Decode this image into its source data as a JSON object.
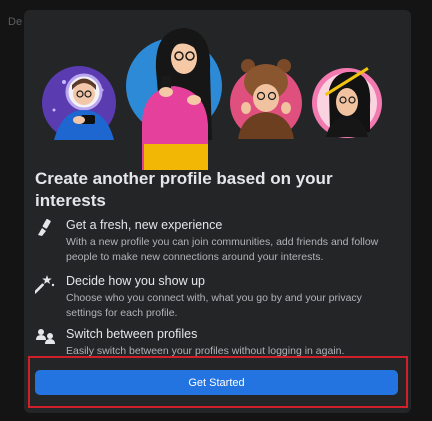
{
  "background": {
    "text": "De"
  },
  "dialog": {
    "title": "Create another profile based on your interests",
    "features": [
      {
        "icon": "paintbrush-icon",
        "heading": "Get a fresh, new experience",
        "desc_lines": [
          "With a new profile you can join communities, add friends and follow",
          "people to make new connections around your interests."
        ]
      },
      {
        "icon": "magic-wand-icon",
        "heading": "Decide how you show up",
        "desc_lines": [
          "Choose who you connect with, what you go by and your privacy",
          "settings for each profile."
        ]
      },
      {
        "icon": "switch-profiles-icon",
        "heading": "Switch between profiles",
        "desc_lines": [
          "Easily switch between your profiles without logging in again."
        ]
      }
    ],
    "cta_label": "Get Started"
  },
  "colors": {
    "accent": "#2374e1",
    "highlight_border": "#d0212b",
    "dialog_bg": "#242526"
  }
}
